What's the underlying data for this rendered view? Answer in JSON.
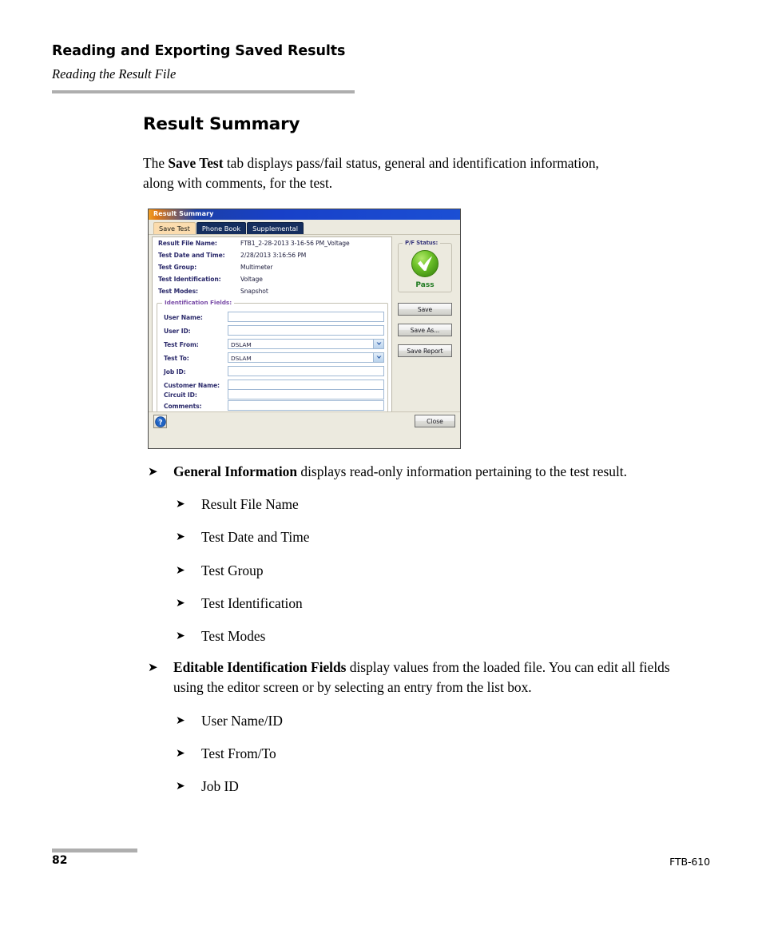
{
  "header": {
    "title": "Reading and Exporting Saved Results",
    "subtitle": "Reading the Result File"
  },
  "section": {
    "heading": "Result Summary",
    "intro_before": "The ",
    "intro_bold": "Save Test",
    "intro_after": " tab displays pass/fail status, general and identification information, along with comments, for the test."
  },
  "dialog": {
    "title": "Result Summary",
    "tabs": [
      {
        "label": "Save Test",
        "active": true
      },
      {
        "label": "Phone Book",
        "active": false
      },
      {
        "label": "Supplemental",
        "active": false
      }
    ],
    "general_info": [
      {
        "label": "Result File Name:",
        "value": "FTB1_2-28-2013 3-16-56 PM_Voltage"
      },
      {
        "label": "Test Date and Time:",
        "value": "2/28/2013 3:16:56 PM"
      },
      {
        "label": "Test Group:",
        "value": "Multimeter"
      },
      {
        "label": "Test Identification:",
        "value": "Voltage"
      },
      {
        "label": "Test Modes:",
        "value": "Snapshot"
      }
    ],
    "identification_legend": "Identification Fields:",
    "identification_fields": [
      {
        "label": "User Name:",
        "value": "",
        "type": "text"
      },
      {
        "label": "User ID:",
        "value": "",
        "type": "text"
      },
      {
        "label": "Test From:",
        "value": "DSLAM",
        "type": "combo"
      },
      {
        "label": "Test To:",
        "value": "DSLAM",
        "type": "combo"
      },
      {
        "label": "Job ID:",
        "value": "",
        "type": "text"
      },
      {
        "label": "Customer Name:",
        "value": "",
        "type": "text"
      },
      {
        "label": "Circuit ID:",
        "value": "",
        "type": "text"
      },
      {
        "label": "Comments:",
        "value": "",
        "type": "text"
      }
    ],
    "pf_status": {
      "legend": "P/F Status:",
      "result": "Pass",
      "color": "#1f7a20"
    },
    "buttons": {
      "save": "Save",
      "save_as": "Save As...",
      "save_report": "Save Report",
      "close": "Close"
    }
  },
  "bullets": [
    {
      "lead_bold": "General Information",
      "lead_rest": " displays read-only information pertaining to the test result.",
      "sub": [
        "Result File Name",
        "Test Date and Time",
        "Test Group",
        "Test Identification",
        "Test Modes"
      ]
    },
    {
      "lead_bold": "Editable Identification Fields",
      "lead_rest": " display values from the loaded file. You can edit all fields using the editor screen or by selecting an entry from the list box.",
      "sub": [
        "User Name/ID",
        "Test From/To",
        "Job ID"
      ]
    }
  ],
  "footer": {
    "page_number": "82",
    "doc_id": "FTB-610"
  },
  "icons": {
    "bullet_arrow": "➤",
    "chevron_down": "chevron-down-icon",
    "help": "question-mark-icon",
    "pass_check": "green-check-circle-icon"
  }
}
